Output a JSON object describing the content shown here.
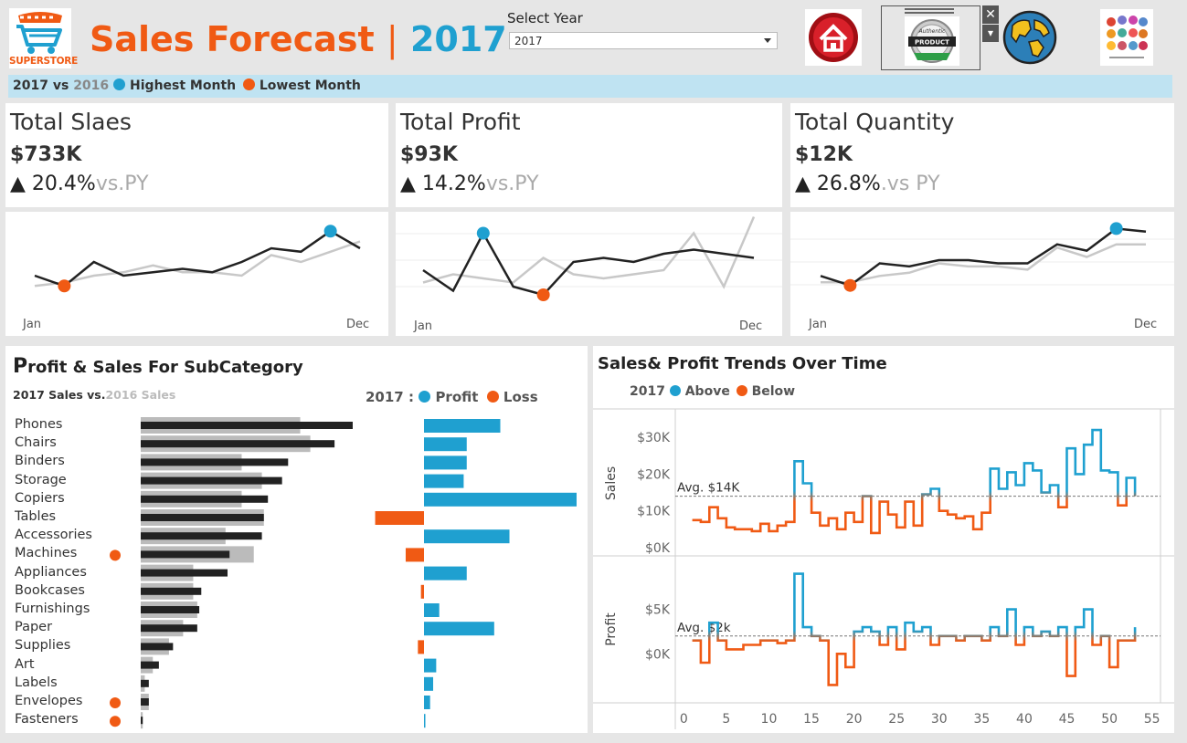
{
  "header": {
    "logo_text": "SUPERSTORE",
    "title": "Sales Forecast",
    "separator": "|",
    "year": "2017",
    "select_label": "Select Year",
    "select_value": "2017",
    "close_glyph": "✕",
    "menu_glyph": "▾",
    "badge_line1": "Authentic",
    "badge_line2": "PRODUCT",
    "icons": [
      "home-icon",
      "authentic-product-icon",
      "globe-icon",
      "product-grid-icon"
    ]
  },
  "legend_bar": {
    "current": "2017",
    "vs": "vs",
    "previous": "2016",
    "highest": "Highest Month",
    "lowest": "Lowest Month"
  },
  "colors": {
    "orange": "#f05a14",
    "blue": "#1fa0d0",
    "dark": "#222222",
    "gray": "#bbbbbb",
    "legend_bg": "#bfe3f2"
  },
  "kpis": [
    {
      "title": "Total Slaes",
      "value": "$733K",
      "arrow": "▲",
      "change": "20.4%",
      "vs": "vs.PY",
      "start_label": "Jan",
      "end_label": "Dec"
    },
    {
      "title": "Total Profit",
      "value": "$93K",
      "arrow": "▲",
      "change": "14.2%",
      "vs": "vs.PY",
      "start_label": "Jan",
      "end_label": "Dec"
    },
    {
      "title": "Total Quantity",
      "value": "$12K",
      "arrow": "▲",
      "change": "26.8%",
      "vs": ".vs PY",
      "start_label": "Jan",
      "end_label": "Dec"
    }
  ],
  "sparklines": [
    {
      "current": [
        8,
        5,
        12,
        8,
        9,
        10,
        9,
        12,
        16,
        15,
        21,
        16
      ],
      "previous": [
        5,
        6,
        8,
        9,
        11,
        9,
        9,
        8,
        14,
        12,
        15,
        18
      ],
      "high_index": 10,
      "low_index": 1,
      "ylim": [
        0,
        24
      ]
    },
    {
      "current": [
        3,
        -2,
        12,
        -1,
        -3,
        5,
        6,
        5,
        7,
        8,
        7,
        6
      ],
      "previous": [
        0,
        2,
        1,
        0,
        6,
        2,
        1,
        2,
        3,
        12,
        -1,
        16
      ],
      "high_index": 2,
      "low_index": 4,
      "ylim": [
        -5,
        15
      ]
    },
    {
      "current": [
        8,
        5,
        12,
        11,
        13,
        13,
        12,
        12,
        18,
        16,
        23,
        22
      ],
      "previous": [
        6,
        6,
        8,
        9,
        12,
        11,
        11,
        10,
        17,
        14,
        18,
        18
      ],
      "high_index": 10,
      "low_index": 1,
      "ylim": [
        0,
        26
      ]
    }
  ],
  "subcategory": {
    "title_first": "P",
    "title_rest": "rofit & Sales For SubCategory",
    "legend_current": "2017 Sales vs.",
    "legend_previous": "2016 Sales",
    "profit_legend_year": "2017 :",
    "profit_legend_profit": "Profit",
    "profit_legend_loss": "Loss"
  },
  "chart_data": [
    {
      "type": "bar",
      "title": "Profit & Sales For SubCategory",
      "categories": [
        "Phones",
        "Chairs",
        "Binders",
        "Storage",
        "Copiers",
        "Tables",
        "Accessories",
        "Machines",
        "Appliances",
        "Bookcases",
        "Furnishings",
        "Paper",
        "Supplies",
        "Art",
        "Labels",
        "Envelopes",
        "Fasteners"
      ],
      "loss_flags": [
        false,
        false,
        false,
        false,
        false,
        false,
        false,
        true,
        false,
        false,
        false,
        false,
        false,
        false,
        false,
        true,
        true
      ],
      "series": [
        {
          "name": "2017 Sales",
          "values": [
            105000,
            96000,
            73000,
            70000,
            63000,
            61000,
            60000,
            44000,
            43000,
            30000,
            29000,
            28000,
            16000,
            9000,
            4000,
            4000,
            1000
          ]
        },
        {
          "name": "2016 Sales",
          "values": [
            79000,
            84000,
            50000,
            60000,
            50000,
            61000,
            42000,
            56000,
            26000,
            26000,
            28000,
            21000,
            14000,
            6000,
            2000,
            4000,
            1000
          ]
        },
        {
          "name": "Profit",
          "values": [
            12500,
            7000,
            7000,
            6500,
            25000,
            -8000,
            14000,
            -3000,
            7000,
            -500,
            2500,
            11500,
            -1000,
            2000,
            1500,
            1000,
            200
          ]
        }
      ]
    },
    {
      "type": "line",
      "title": "Sales& Profit Trends Over Time",
      "legend_year": "2017",
      "legend_above": "Above",
      "legend_below": "Below",
      "x": [
        1,
        2,
        3,
        4,
        5,
        6,
        7,
        8,
        9,
        10,
        11,
        12,
        13,
        14,
        15,
        16,
        17,
        18,
        19,
        20,
        21,
        22,
        23,
        24,
        25,
        26,
        27,
        28,
        29,
        30,
        31,
        32,
        33,
        34,
        35,
        36,
        37,
        38,
        39,
        40,
        41,
        42,
        43,
        44,
        45,
        46,
        47,
        48,
        49,
        50,
        51,
        52,
        53
      ],
      "xticks": [
        0,
        5,
        10,
        15,
        20,
        25,
        30,
        35,
        40,
        45,
        50,
        55
      ],
      "xlim": [
        -1,
        56
      ],
      "sales": {
        "ylabel": "Sales",
        "ylim": [
          -1000,
          36000
        ],
        "yticks": [
          {
            "v": 0,
            "label": "$0K"
          },
          {
            "v": 10000,
            "label": "$10K"
          },
          {
            "v": 20000,
            "label": "$20K"
          },
          {
            "v": 30000,
            "label": "$30K"
          }
        ],
        "avg": 14000,
        "avg_label": "Avg. $14K",
        "values": [
          7500,
          7000,
          11000,
          8000,
          5500,
          5000,
          5000,
          4500,
          6500,
          4500,
          6000,
          7000,
          23500,
          17500,
          9500,
          6000,
          8000,
          5000,
          9500,
          7000,
          14000,
          4000,
          12500,
          9000,
          5500,
          12500,
          6000,
          14500,
          16000,
          10000,
          9000,
          8000,
          8500,
          5000,
          9500,
          21500,
          16000,
          20500,
          17000,
          23000,
          21000,
          15000,
          17000,
          11000,
          27000,
          20000,
          28000,
          32000,
          21000,
          20500,
          11500,
          19000,
          14000
        ]
      },
      "profit": {
        "ylabel": "Profit",
        "ylim": [
          -5000,
          10500
        ],
        "yticks": [
          {
            "v": 0,
            "label": "$0K"
          },
          {
            "v": 5000,
            "label": "$5K"
          }
        ],
        "avg": 2000,
        "avg_label": "Avg. $2k",
        "values": [
          1500,
          -1000,
          3500,
          1500,
          500,
          500,
          1000,
          1000,
          1500,
          1500,
          1200,
          1500,
          9000,
          3000,
          2000,
          1500,
          -3500,
          0,
          -1500,
          2500,
          3000,
          2500,
          1000,
          3000,
          500,
          3500,
          2500,
          3000,
          1000,
          2000,
          2000,
          1500,
          2000,
          2000,
          1500,
          3000,
          2000,
          5000,
          1000,
          3000,
          2000,
          2500,
          2000,
          3000,
          -2500,
          3000,
          5000,
          1000,
          2000,
          -1500,
          1500,
          1500,
          3000
        ]
      }
    }
  ]
}
